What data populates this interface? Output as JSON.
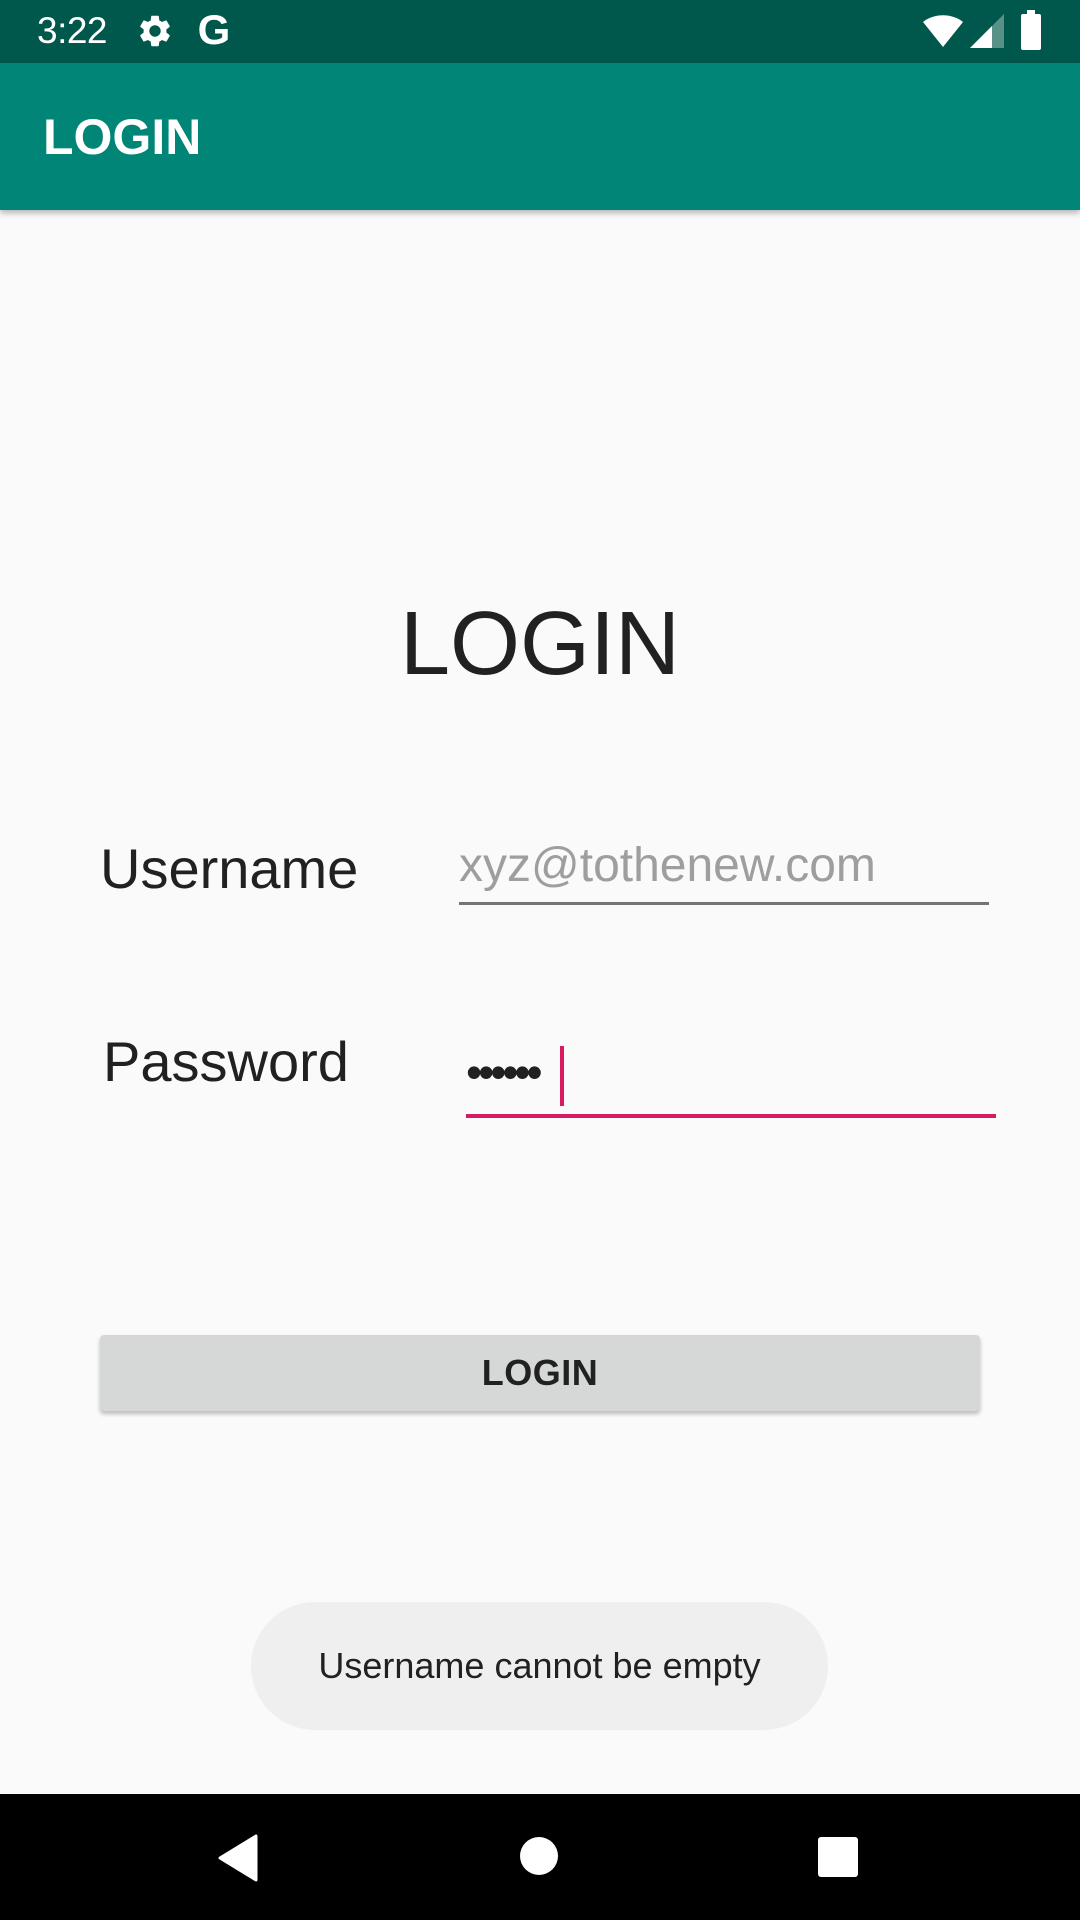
{
  "status_bar": {
    "time": "3:22",
    "google_glyph": "G",
    "icons": [
      "gear-icon",
      "google-icon",
      "wifi-icon",
      "signal-icon",
      "battery-icon"
    ]
  },
  "app_bar": {
    "title": "LOGIN"
  },
  "form": {
    "heading": "LOGIN",
    "username_label": "Username",
    "username_placeholder": "xyz@tothenew.com",
    "username_value": "",
    "password_label": "Password",
    "password_value": "••••••",
    "login_button_label": "LOGIN"
  },
  "toast": {
    "message": "Username cannot be empty"
  },
  "nav_bar": {
    "buttons": [
      "back-icon",
      "home-icon",
      "recents-icon"
    ]
  },
  "colors": {
    "status_bar": "#00574b",
    "app_bar": "#008577",
    "accent": "#d81b60",
    "button": "#d6d7d7",
    "toast": "#efefef"
  }
}
